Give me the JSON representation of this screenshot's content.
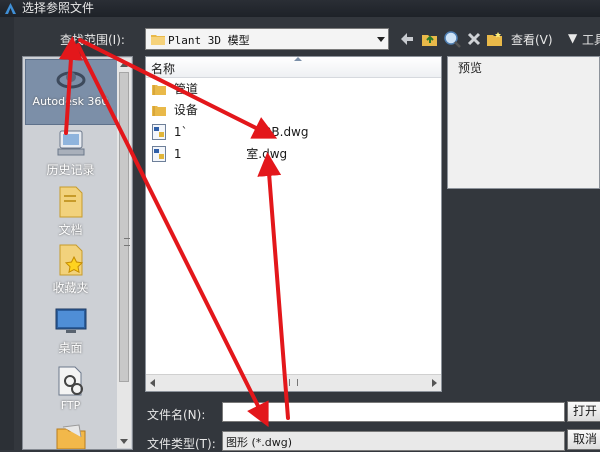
{
  "window": {
    "title": "选择参照文件"
  },
  "toolbar": {
    "look_in_label": "查找范围(I):",
    "look_in_value": "Plant 3D 模型",
    "views_label": "查看(V)",
    "tools_label": "工具"
  },
  "places": {
    "items": [
      {
        "label": "Autodesk 360"
      },
      {
        "label": "历史记录"
      },
      {
        "label": "文档"
      },
      {
        "label": "收藏夹"
      },
      {
        "label": "桌面"
      },
      {
        "label": "FTP"
      }
    ]
  },
  "filelist": {
    "column_name": "名称",
    "rows": [
      {
        "name": "管道",
        "kind": "folder"
      },
      {
        "name": "设备",
        "kind": "folder"
      },
      {
        "name": "1`                 .03B.dwg",
        "kind": "dwg"
      },
      {
        "name": "1                 室.dwg",
        "kind": "dwg"
      }
    ]
  },
  "preview": {
    "label": "预览"
  },
  "filename": {
    "label": "文件名(N):",
    "value": ""
  },
  "filetype": {
    "label": "文件类型(T):",
    "value": "图形 (*.dwg)"
  },
  "buttons": {
    "open": "打开",
    "cancel": "取消"
  },
  "colors": {
    "annotation_arrow": "#e3171b",
    "selected_place": "#7c8fa8"
  }
}
